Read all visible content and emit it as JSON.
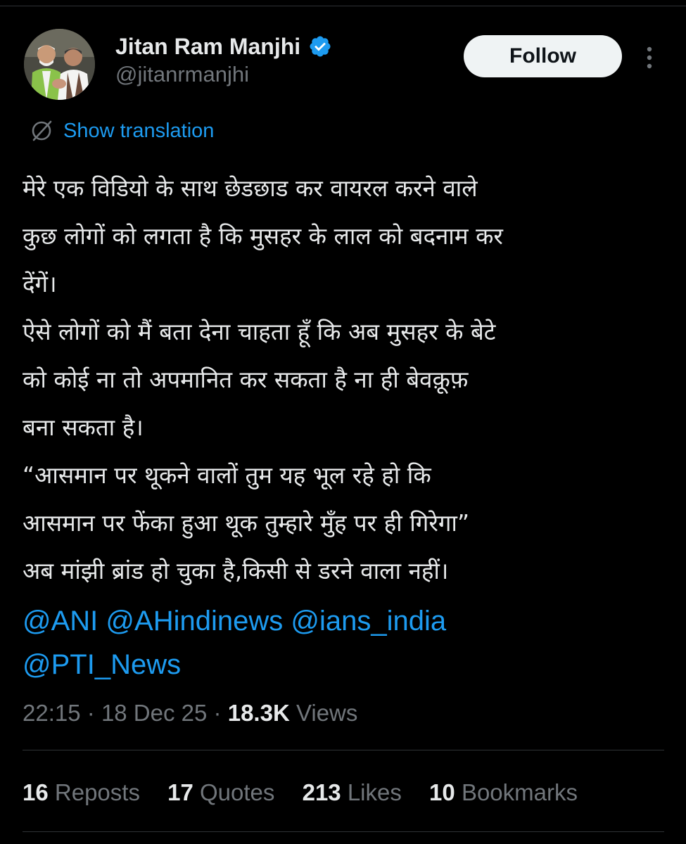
{
  "author": {
    "display_name": "Jitan Ram Manjhi",
    "handle": "@jitanrmanjhi",
    "verified": true,
    "verified_icon": "verified-badge-icon",
    "avatar": "profile-photo"
  },
  "actions": {
    "follow_label": "Follow",
    "more_icon": "more-vertical-icon"
  },
  "translation": {
    "label": "Show translation",
    "icon": "translate-icon"
  },
  "tweet": {
    "lines": [
      "मेरे एक विडियो के साथ छेडछाड कर वायरल करने वाले",
      "कुछ लोगों को लगता है कि मुसहर के लाल को बदनाम कर",
      "देंगें।",
      "ऐसे लोगों को मैं बता देना चाहता हूँ कि अब मुसहर के बेटे",
      "को कोई ना तो अपमानित कर सकता है ना ही बेवक़ूफ़",
      "बना सकता है।",
      "“आसमान पर थूकने वालों तुम यह भूल रहे हो कि",
      "आसमान पर फेंका हुआ थूक तुम्हारे मुँह पर ही गिरेगा”",
      "अब मांझी ब्रांड हो चुका है,किसी से डरने वाला नहीं।"
    ],
    "mentions": [
      "@ANI",
      "@AHindinews",
      "@ians_india",
      "@PTI_News"
    ]
  },
  "meta": {
    "time": "22:15",
    "separator": "·",
    "date": "18 Dec 25",
    "views_count": "18.3K",
    "views_label": "Views"
  },
  "stats": [
    {
      "count": "16",
      "label": "Reposts"
    },
    {
      "count": "17",
      "label": "Quotes"
    },
    {
      "count": "213",
      "label": "Likes"
    },
    {
      "count": "10",
      "label": "Bookmarks"
    }
  ],
  "colors": {
    "background": "#000000",
    "text": "#e7e9ea",
    "muted": "#71767b",
    "link": "#1d9bf0",
    "divider": "#2f3336"
  }
}
